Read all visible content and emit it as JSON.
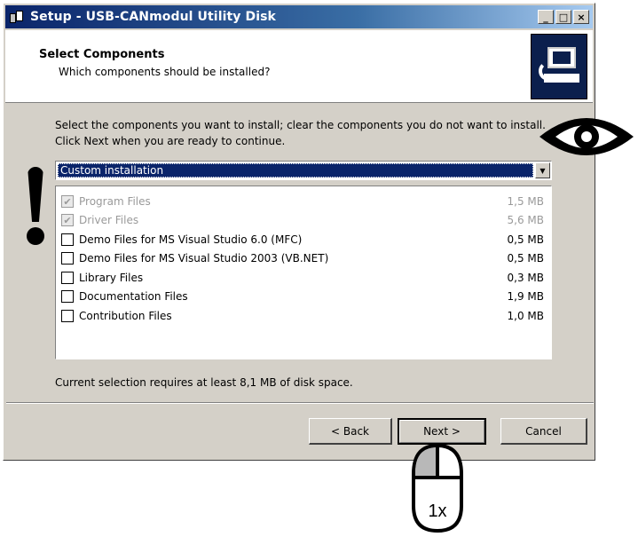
{
  "window": {
    "title": "Setup - USB-CANmodul Utility Disk",
    "minimize": "_",
    "maximize": "□",
    "close": "×"
  },
  "header": {
    "title": "Select Components",
    "subtitle": "Which components should be installed?"
  },
  "instructions": "Select the components you want to install; clear the components you do not want to install. Click Next when you are ready to continue.",
  "combo": {
    "value": "Custom installation",
    "arrow": "▼"
  },
  "components": [
    {
      "name": "Program Files",
      "size": "1,5 MB",
      "checked": true,
      "disabled": true
    },
    {
      "name": "Driver Files",
      "size": "5,6 MB",
      "checked": true,
      "disabled": true
    },
    {
      "name": "Demo Files for MS Visual Studio 6.0 (MFC)",
      "size": "0,5 MB",
      "checked": false,
      "disabled": false
    },
    {
      "name": "Demo Files for MS Visual Studio 2003 (VB.NET)",
      "size": "0,5 MB",
      "checked": false,
      "disabled": false
    },
    {
      "name": "Library Files",
      "size": "0,3 MB",
      "checked": false,
      "disabled": false
    },
    {
      "name": "Documentation Files",
      "size": "1,9 MB",
      "checked": false,
      "disabled": false
    },
    {
      "name": "Contribution Files",
      "size": "1,0 MB",
      "checked": false,
      "disabled": false
    }
  ],
  "status": "Current selection requires at least 8,1 MB of disk space.",
  "buttons": {
    "back": "< Back",
    "next": "Next >",
    "cancel": "Cancel"
  },
  "annotation": {
    "click_count": "1x"
  }
}
